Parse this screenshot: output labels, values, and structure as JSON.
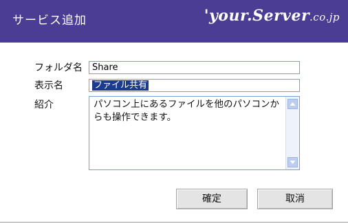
{
  "dialog": {
    "title": "サービス追加",
    "brand_main": "'your.Server",
    "brand_sub": ".co.jp"
  },
  "form": {
    "folder_label": "フォルダ名",
    "folder_value": "Share",
    "display_label": "表示名",
    "display_value": "ファイル共有",
    "description_label": "紹介",
    "description_value": "パソコン上にあるファイルを他のパソコンからも操作できます。"
  },
  "buttons": {
    "ok_label": "確定",
    "cancel_label": "取消"
  },
  "colors": {
    "titlebar": "#4b3d93",
    "field_border": "#7d9ed4",
    "selection": "#1c3b8e"
  }
}
